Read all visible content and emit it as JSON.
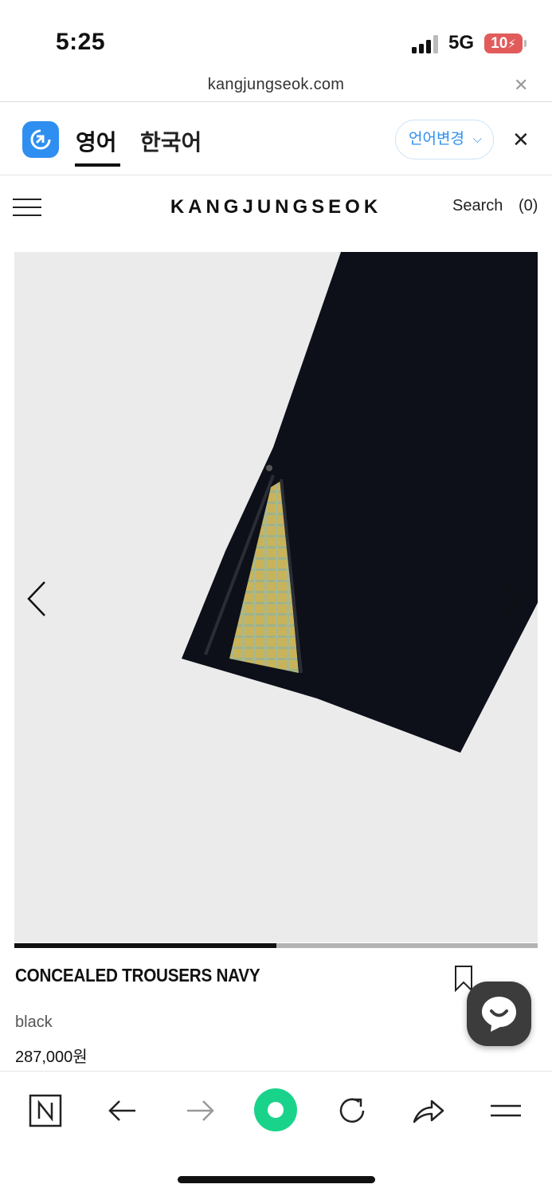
{
  "status_bar": {
    "time": "5:25",
    "network": "5G",
    "battery": "10"
  },
  "browser": {
    "url": "kangjungseok.com",
    "close_icon": "close-icon"
  },
  "translate_bar": {
    "tabs": [
      "영어",
      "한국어"
    ],
    "active_tab": "영어",
    "change_language_label": "언어변경",
    "accent_color": "#2f8ff0"
  },
  "site": {
    "brand": "KANGJUNGSEOK",
    "search_label": "Search",
    "cart_label": "(0)"
  },
  "gallery": {
    "progress_fraction": 0.5
  },
  "product": {
    "title": "CONCEALED TROUSERS NAVY",
    "color": "black",
    "price": "287,000원"
  },
  "toolbar": {
    "items": [
      "n-home-icon",
      "back-arrow-icon",
      "forward-arrow-icon",
      "green-dot-icon",
      "reload-icon",
      "share-icon",
      "menu-icon"
    ]
  }
}
